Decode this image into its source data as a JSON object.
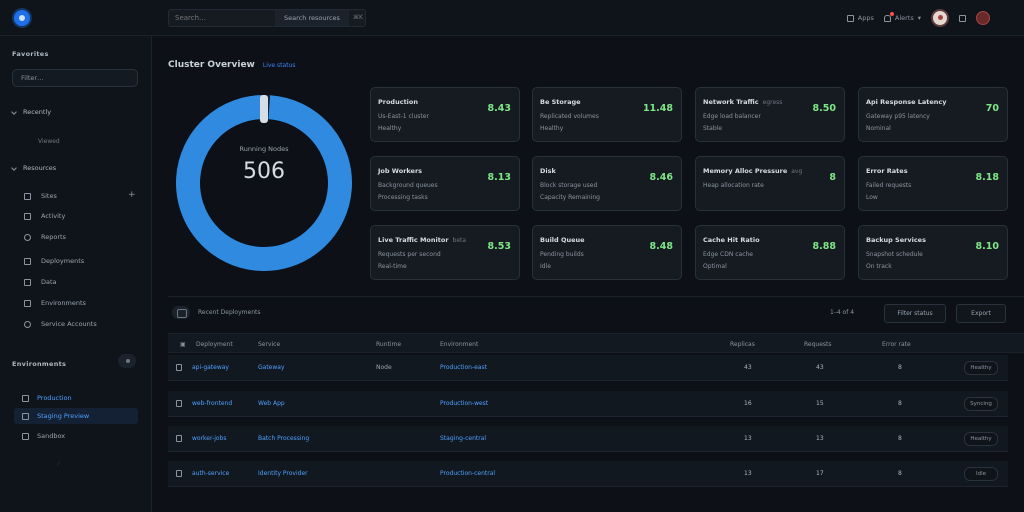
{
  "topbar": {
    "search_placeholder": "Search…",
    "search_scope": "Search resources",
    "kbd": "⌘K",
    "items": [
      {
        "icon": "grid-icon",
        "label": "Apps"
      },
      {
        "icon": "bell-icon",
        "label": "Alerts"
      },
      {
        "icon": "help-icon",
        "label": "Help"
      }
    ]
  },
  "sidebar": {
    "heading": "Favorites",
    "filter_placeholder": "Filter…",
    "groups": [
      {
        "label": "Recently",
        "sub": "Viewed"
      },
      {
        "label": "Resources"
      }
    ],
    "items": [
      {
        "icon": "server-icon",
        "label": "Sites"
      },
      {
        "icon": "activity-icon",
        "label": "Activity"
      },
      {
        "icon": "report-icon",
        "label": "Reports"
      },
      {
        "icon": "deployments-icon",
        "label": "Deployments"
      },
      {
        "icon": "data-icon",
        "label": "Data"
      },
      {
        "icon": "environments-icon",
        "label": "Environments"
      },
      {
        "icon": "settings-icon",
        "label": "Service Accounts"
      }
    ],
    "projects_heading": "Environments",
    "projects": [
      {
        "label": "Production",
        "active": false,
        "plain": false
      },
      {
        "label": "Staging Preview",
        "active": true,
        "plain": false
      },
      {
        "label": "Sandbox",
        "active": false,
        "plain": true
      }
    ]
  },
  "main": {
    "title": "Cluster Overview",
    "subtitle": "Live status"
  },
  "donut": {
    "label": "Running Nodes",
    "value": "506",
    "fraction": 0.99,
    "color": "#2f8ae0",
    "track": "#13263b"
  },
  "stats": [
    {
      "title": "Production",
      "tag": "",
      "sub1": "Us-East-1 cluster",
      "sub2": "Healthy",
      "value": "8.43"
    },
    {
      "title": "Be Storage",
      "tag": "",
      "sub1": "Replicated volumes",
      "sub2": "Healthy",
      "value": "11.48"
    },
    {
      "title": "Network Traffic",
      "tag": "egress",
      "sub1": "Edge load balancer",
      "sub2": "Stable",
      "value": "8.50"
    },
    {
      "title": "Api Response Latency",
      "tag": "",
      "sub1": "Gateway p95 latency",
      "sub2": "Nominal",
      "value": "70"
    },
    {
      "title": "Job Workers",
      "tag": "",
      "sub1": "Background queues",
      "sub2": "Processing tasks",
      "value": "8.13"
    },
    {
      "title": "Disk",
      "tag": "",
      "sub1": "Block storage used",
      "sub2": "Capacity Remaining",
      "value": "8.46"
    },
    {
      "title": "Memory Alloc Pressure",
      "tag": "avg",
      "sub1": "Heap allocation rate",
      "sub2": "",
      "value": "8"
    },
    {
      "title": "Error Rates",
      "tag": "",
      "sub1": "Failed requests",
      "sub2": "Low",
      "value": "8.18"
    },
    {
      "title": "Live Traffic Monitor",
      "tag": "beta",
      "sub1": "Requests per second",
      "sub2": "Real-time",
      "value": "8.53"
    },
    {
      "title": "Build Queue",
      "tag": "",
      "sub1": "Pending builds",
      "sub2": "Idle",
      "value": "8.48"
    },
    {
      "title": "Cache Hit Ratio",
      "tag": "",
      "sub1": "Edge CDN cache",
      "sub2": "Optimal",
      "value": "8.88"
    },
    {
      "title": "Backup Services",
      "tag": "",
      "sub1": "Snapshot schedule",
      "sub2": "On track",
      "value": "8.10"
    }
  ],
  "table": {
    "title": "Recent Deployments",
    "count_label": "1–4 of 4",
    "filter_label": "Filter status",
    "export_label": "Export",
    "headers": [
      "Deployment",
      "Service",
      "Runtime",
      "Environment",
      "Replicas",
      "Requests",
      "Error rate",
      ""
    ],
    "rows": [
      {
        "name": "api-gateway",
        "service": "Gateway",
        "runtime": "Node",
        "env": "Production-east",
        "c1": "43",
        "c2": "43",
        "c3": "8",
        "status": "Healthy"
      },
      {
        "name": "web-frontend",
        "service": "Web App",
        "runtime": "",
        "env": "Production-west",
        "c1": "16",
        "c2": "15",
        "c3": "8",
        "status": "Syncing"
      },
      {
        "name": "worker-jobs",
        "service": "Batch Processing",
        "runtime": "",
        "env": "Staging-central",
        "c1": "13",
        "c2": "13",
        "c3": "8",
        "status": "Healthy"
      },
      {
        "name": "auth-service",
        "service": "Identity Provider",
        "runtime": "",
        "env": "Production-central",
        "c1": "13",
        "c2": "17",
        "c3": "8",
        "status": "Idle"
      }
    ]
  }
}
